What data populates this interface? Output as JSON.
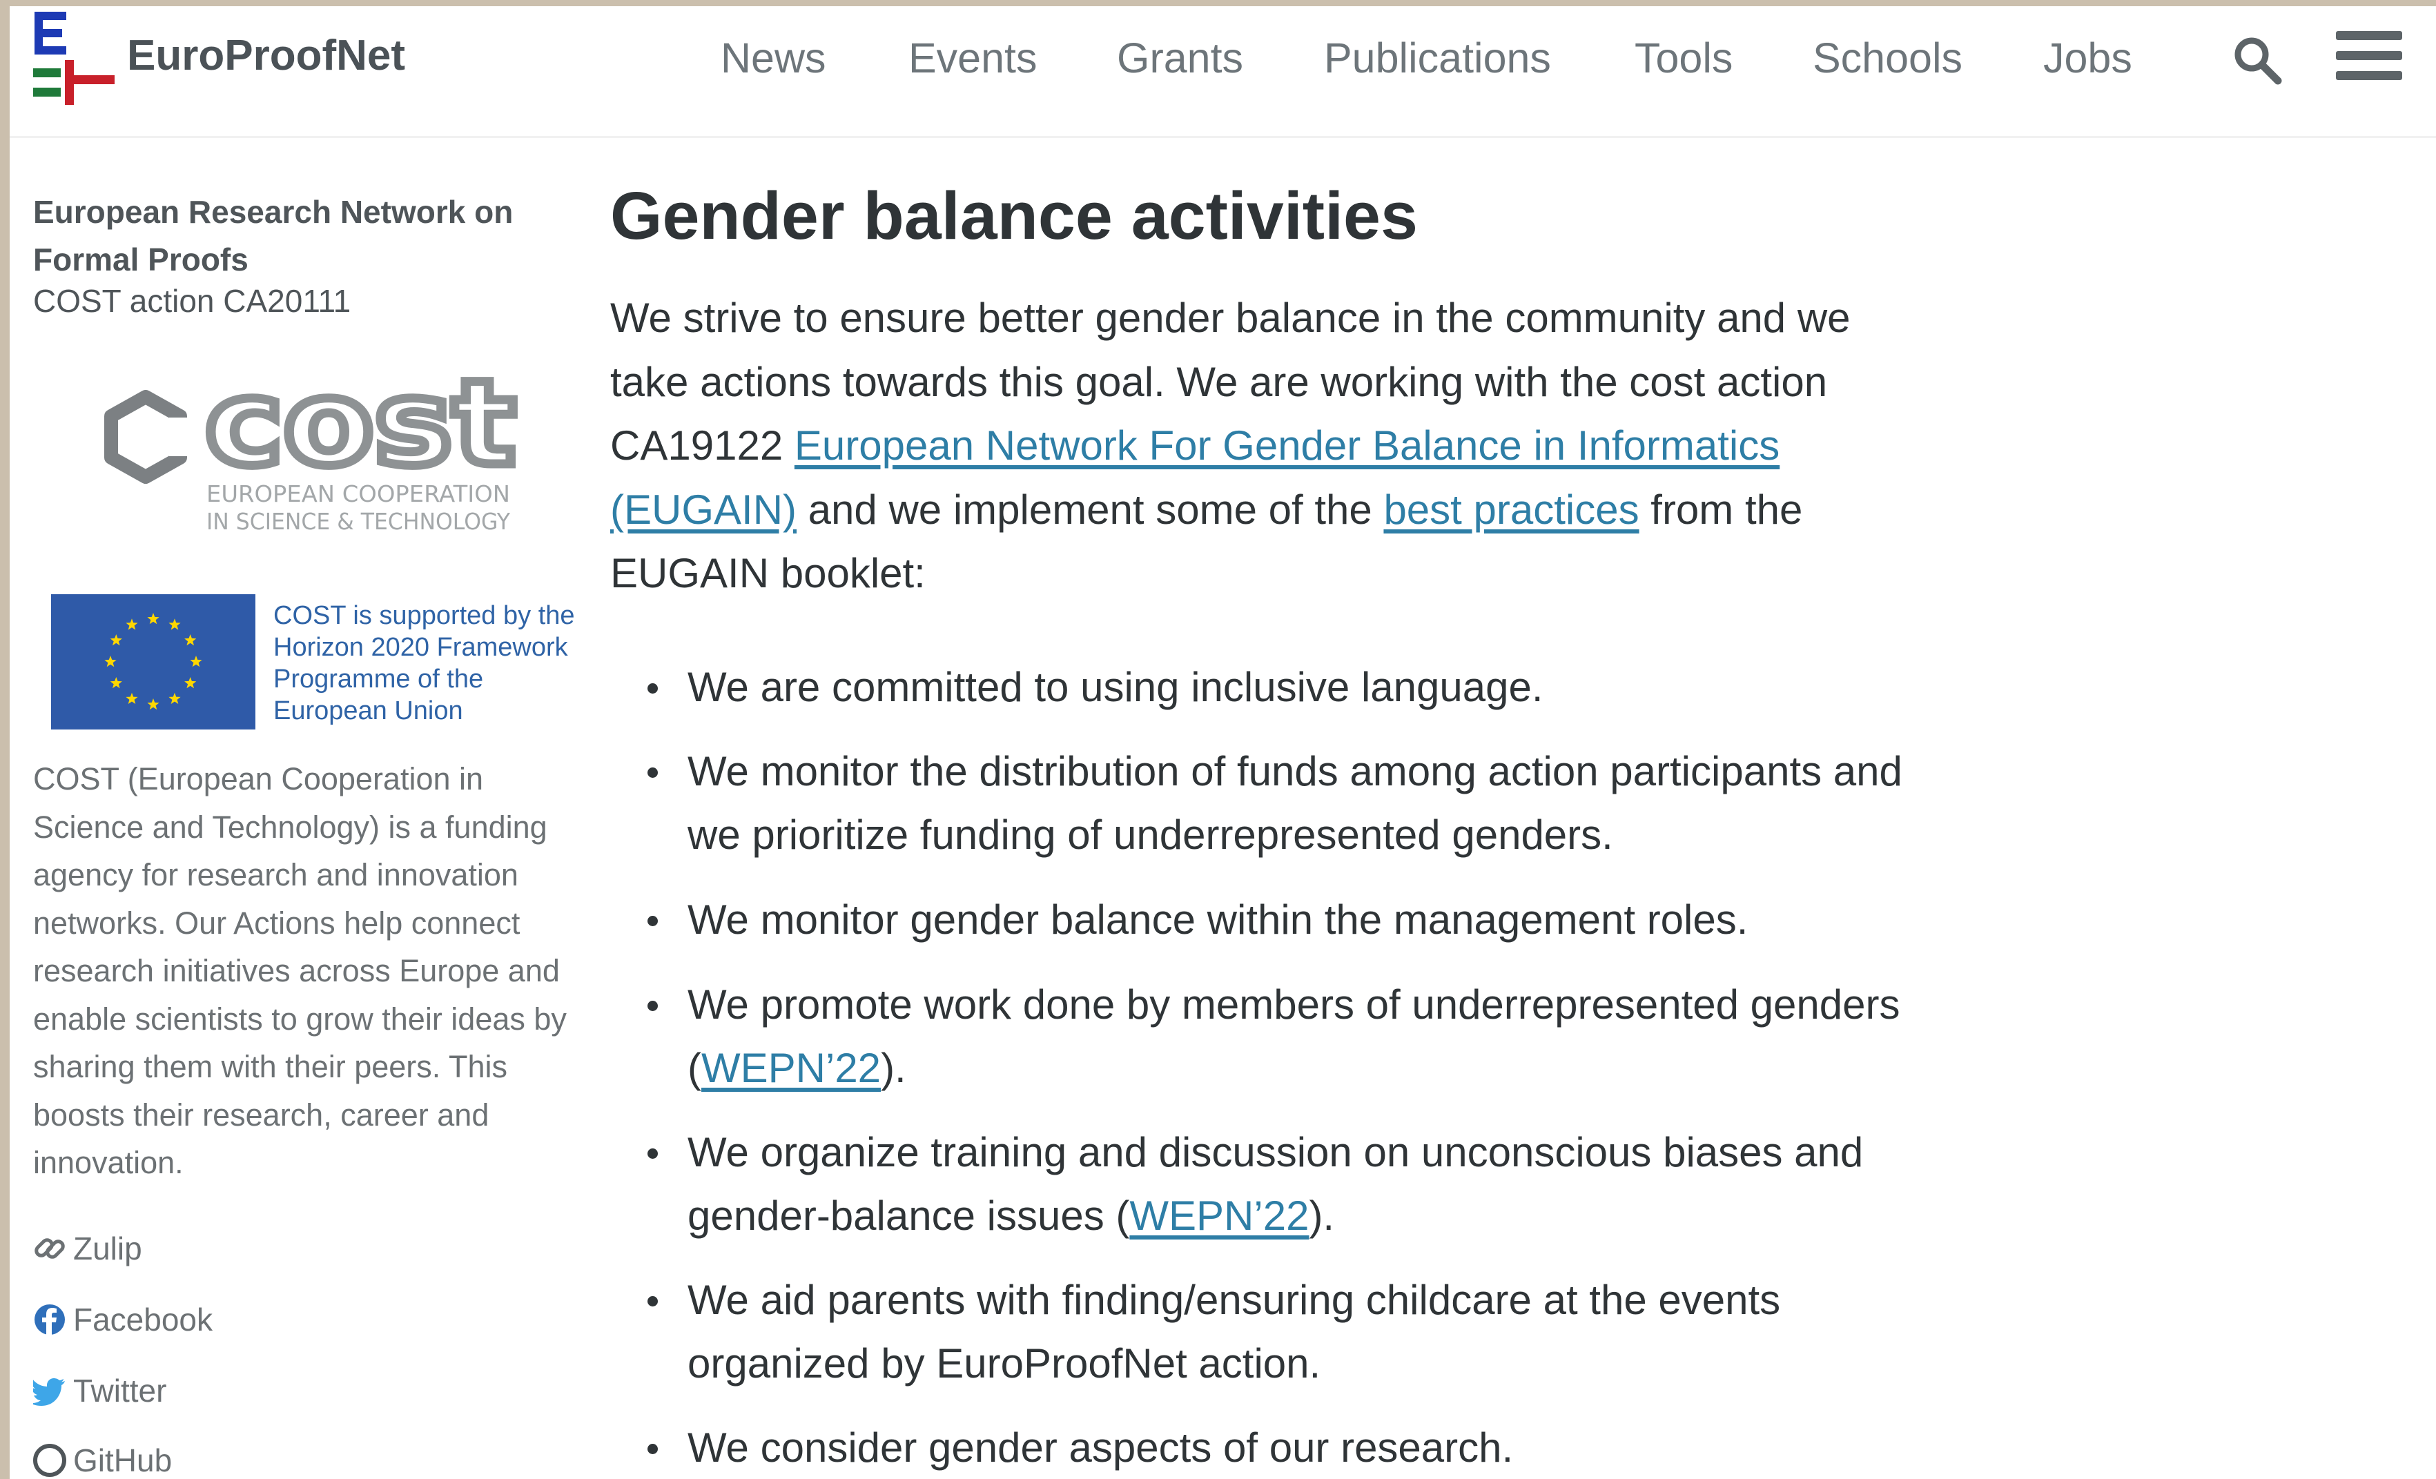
{
  "header": {
    "brand": "EuroProofNet",
    "nav": [
      "News",
      "Events",
      "Grants",
      "Publications",
      "Tools",
      "Schools",
      "Jobs"
    ]
  },
  "sidebar": {
    "title": "European Research Network on Formal Proofs",
    "subtitle": "COST action CA20111",
    "cost_logo": {
      "word": "cost",
      "line1": "EUROPEAN COOPERATION",
      "line2": "IN SCIENCE & TECHNOLOGY"
    },
    "eu_text": "COST is supported by the Horizon 2020 Framework Programme of the European Union",
    "description": "COST (European Cooperation in Science and Technology) is a funding agency for research and innovation networks. Our Actions help connect research initiatives across Europe and enable scientists to grow their ideas by sharing them with their peers. This boosts their research, career and innovation.",
    "links": [
      {
        "label": "Zulip",
        "icon": "link-icon"
      },
      {
        "label": "Facebook",
        "icon": "facebook-icon"
      },
      {
        "label": "Twitter",
        "icon": "twitter-icon"
      },
      {
        "label": "GitHub",
        "icon": "github-icon"
      }
    ]
  },
  "main": {
    "title": "Gender balance activities",
    "intro": {
      "p1": "We strive to ensure better gender balance in the community and we take actions towards this goal. We are working with the cost action CA19122 ",
      "link1": "European Network For Gender Balance in Informatics (EUGAIN)",
      "p2": " and we implement some of the ",
      "link2": "best practices",
      "p3": " from the EUGAIN booklet:"
    },
    "bullets": [
      {
        "text": "We are committed to using inclusive language."
      },
      {
        "text": "We monitor the distribution of funds among action participants and we prioritize funding of underrepresented genders."
      },
      {
        "text": "We monitor gender balance within the management roles."
      },
      {
        "text": "We promote work done by members of underrepresented genders (",
        "link": "WEPN’22",
        "after": ")."
      },
      {
        "text": "We organize training and discussion on unconscious biases and gender-balance issues (",
        "link": "WEPN’22",
        "after": ")."
      },
      {
        "text": "We aid parents with finding/ensuring childcare at the events organized by EuroProofNet action."
      },
      {
        "text": "We consider gender aspects of our research."
      }
    ]
  },
  "colors": {
    "accent_link": "#2e7ea6",
    "logo_blue": "#1d3ab4",
    "logo_green": "#1f7a3a",
    "logo_red": "#c8202a",
    "eu_blue": "#2f5aa8",
    "eu_star": "#ffd700"
  }
}
